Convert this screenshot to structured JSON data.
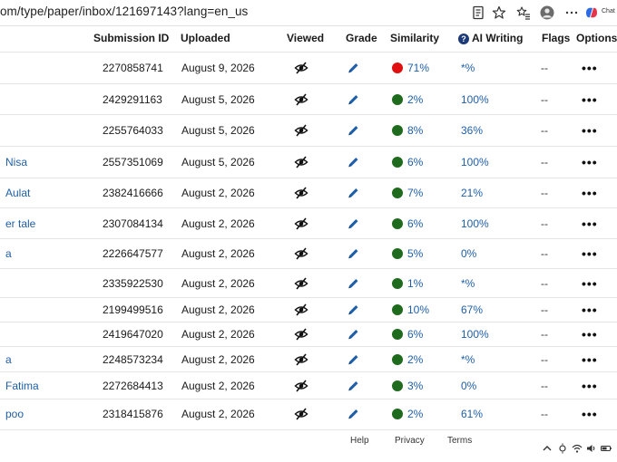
{
  "browser": {
    "url": "om/type/paper/inbox/121697143?lang=en_us",
    "chat_label": "Chat"
  },
  "table": {
    "columns": {
      "submission_id": "Submission ID",
      "uploaded": "Uploaded",
      "viewed": "Viewed",
      "grade": "Grade",
      "similarity": "Similarity",
      "ai_writing": "AI Writing",
      "flags": "Flags",
      "options": "Options"
    },
    "rows": [
      {
        "name": "",
        "id": "2270858741",
        "date": "August 9, 2026",
        "sim": "71%",
        "sim_color": "#e01010",
        "ai": "*%",
        "flags": "--"
      },
      {
        "name": "",
        "id": "2429291163",
        "date": "August 5, 2026",
        "sim": "2%",
        "sim_color": "#1e6b1e",
        "ai": "100%",
        "flags": "--"
      },
      {
        "name": "",
        "id": "2255764033",
        "date": "August 5, 2026",
        "sim": "8%",
        "sim_color": "#1e6b1e",
        "ai": "36%",
        "flags": "--"
      },
      {
        "name": "Nisa",
        "id": "2557351069",
        "date": "August 5, 2026",
        "sim": "6%",
        "sim_color": "#1e6b1e",
        "ai": "100%",
        "flags": "--"
      },
      {
        "name": "Aulat",
        "id": "2382416666",
        "date": "August 2, 2026",
        "sim": "7%",
        "sim_color": "#1e6b1e",
        "ai": "21%",
        "flags": "--"
      },
      {
        "name": "er tale",
        "id": "2307084134",
        "date": "August 2, 2026",
        "sim": "6%",
        "sim_color": "#1e6b1e",
        "ai": "100%",
        "flags": "--"
      },
      {
        "name": "a",
        "id": "2226647577",
        "date": "August 2, 2026",
        "sim": "5%",
        "sim_color": "#1e6b1e",
        "ai": "0%",
        "flags": "--"
      },
      {
        "name": "",
        "id": "2335922530",
        "date": "August 2, 2026",
        "sim": "1%",
        "sim_color": "#1e6b1e",
        "ai": "*%",
        "flags": "--"
      },
      {
        "name": "",
        "id": "2199499516",
        "date": "August 2, 2026",
        "sim": "10%",
        "sim_color": "#1e6b1e",
        "ai": "67%",
        "flags": "--"
      },
      {
        "name": "",
        "id": "2419647020",
        "date": "August 2, 2026",
        "sim": "6%",
        "sim_color": "#1e6b1e",
        "ai": "100%",
        "flags": "--"
      },
      {
        "name": "a",
        "id": "2248573234",
        "date": "August 2, 2026",
        "sim": "2%",
        "sim_color": "#1e6b1e",
        "ai": "*%",
        "flags": "--"
      },
      {
        "name": "Fatima",
        "id": "2272684413",
        "date": "August 2, 2026",
        "sim": "3%",
        "sim_color": "#1e6b1e",
        "ai": "0%",
        "flags": "--"
      },
      {
        "name": "poo",
        "id": "2318415876",
        "date": "August 2, 2026",
        "sim": "2%",
        "sim_color": "#1e6b1e",
        "ai": "61%",
        "flags": "--"
      }
    ],
    "options_glyph": "•••"
  },
  "footer": {
    "help": "Help",
    "privacy": "Privacy",
    "terms": "Terms"
  },
  "icons": {
    "viewed": "eye-slash-icon",
    "grade": "pencil-icon",
    "ai_help": "question-circle-icon",
    "ai_help_glyph": "?"
  }
}
